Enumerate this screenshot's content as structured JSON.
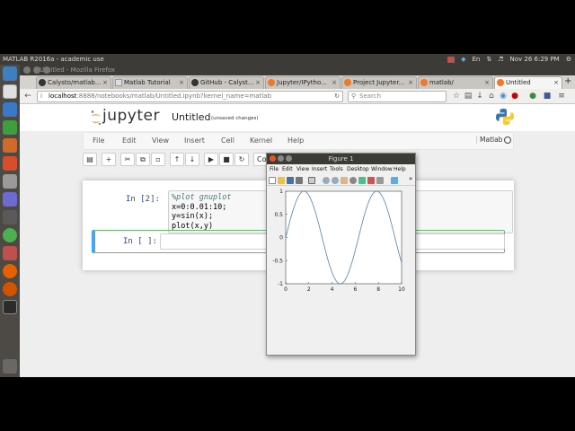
{
  "top_panel": {
    "title": "MATLAB R2016a - academic use",
    "datetime": "Nov 26  6:29 PM"
  },
  "browser": {
    "window_title": "Untitled - Mozilla Firefox",
    "tabs": [
      {
        "label": "Calysto/matlab..."
      },
      {
        "label": "Matlab Tutorial"
      },
      {
        "label": "GitHub - Calyst..."
      },
      {
        "label": "Jupyter/IPytho..."
      },
      {
        "label": "Project Jupyter..."
      },
      {
        "label": "matlab/"
      },
      {
        "label": "Untitled"
      }
    ],
    "url_host": "localhost",
    "url_path": ":8888/notebooks/matlab/Untitled.ipynb?kernel_name=matlab",
    "search_placeholder": "Search"
  },
  "jupyter": {
    "logo_text": "jupyter",
    "notebook_name": "Untitled",
    "save_status": "(unsaved changes)",
    "menu": [
      "File",
      "Edit",
      "View",
      "Insert",
      "Cell",
      "Kernel",
      "Help"
    ],
    "kernel": "Matlab",
    "toolbar_partial_label": "Co",
    "cells": [
      {
        "prompt": "In [2]:",
        "lines": [
          "%plot gnuplot",
          "x=0:0.01:10;",
          "y=sin(x);",
          "plot(x,y)"
        ]
      },
      {
        "prompt": "In [ ]:",
        "lines": []
      }
    ]
  },
  "figure_window": {
    "title": "Figure 1",
    "menu": [
      "File",
      "Edit",
      "View",
      "Insert",
      "Tools",
      "Desktop",
      "Window",
      "Help"
    ]
  },
  "chart_data": {
    "type": "line",
    "function": "y = sin(x)",
    "x_start": 0,
    "x_end": 10,
    "x_step": 0.01,
    "xlim": [
      0,
      10
    ],
    "ylim": [
      -1,
      1
    ],
    "xticks": [
      "0",
      "2",
      "4",
      "6",
      "8",
      "10"
    ],
    "yticks": [
      "1",
      "0.5",
      "0",
      "-0.5",
      "-1"
    ],
    "line_color": "#4f80bd",
    "grid": false
  },
  "colors": {
    "jupyter_orange": "#f37726",
    "prompt_blue": "#303f9f",
    "edit_green": "#66bb6a",
    "selected_blue": "#42a5f5"
  }
}
